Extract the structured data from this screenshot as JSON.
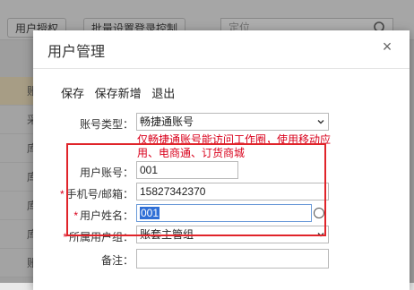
{
  "background": {
    "toolbar_buttons": [
      "用户授权",
      "批量设置登录控制"
    ],
    "search_placeholder": "定位",
    "row_labels": [
      "账",
      "采",
      "库",
      "库",
      "库",
      "库",
      "账"
    ]
  },
  "dialog": {
    "title": "用户管理",
    "close_symbol": "×",
    "actions": [
      "保存",
      "保存新增",
      "退出"
    ]
  },
  "form": {
    "account_type_label": "账号类型：",
    "account_type_value": "畅捷通账号",
    "hint": "仅畅捷通账号能访问工作圈，使用移动应用、电商通、订货商城",
    "user_account_label": "用户账号：",
    "user_account_value": "001",
    "phone_label": "手机号/邮箱：",
    "phone_value": "15827342370",
    "user_name_label": "用户姓名：",
    "user_name_value": "001",
    "user_group_label": "所属用户组：",
    "user_group_value": "账套主管组",
    "remark_label": "备注："
  },
  "colors": {
    "required_mark": "#d9001b",
    "hint_text": "#d9001b",
    "highlight_border": "#e0242a",
    "selection": "#2f6fd6"
  }
}
